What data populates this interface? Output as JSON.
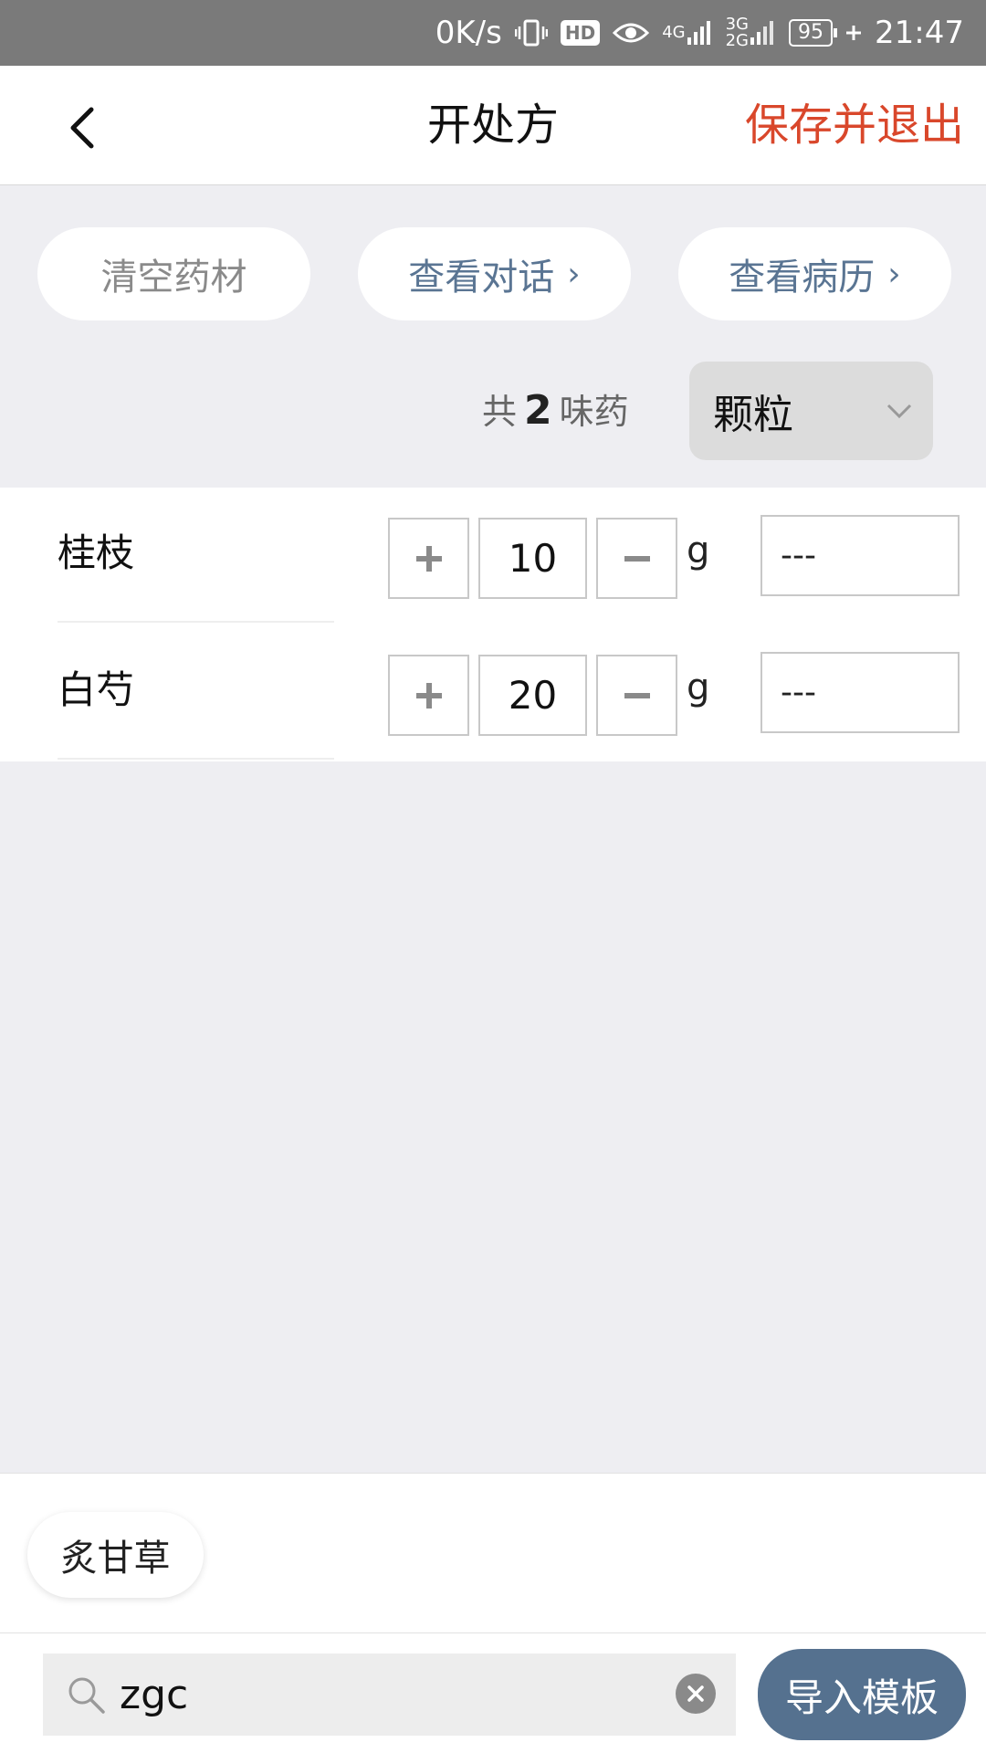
{
  "status_bar": {
    "speed": "0K/s",
    "hd": "HD",
    "net1_top": "4G",
    "net2_top": "3G",
    "net2_bottom": "2G",
    "battery": "95",
    "time": "21:47"
  },
  "header": {
    "title": "开处方",
    "save_exit": "保存并退出"
  },
  "actions": {
    "clear": "清空药材",
    "view_chat": "查看对话",
    "view_record": "查看病历",
    "chevron": "›"
  },
  "summary": {
    "prefix": "共",
    "count": "2",
    "suffix": "味药"
  },
  "dosage_form": {
    "selected": "颗粒"
  },
  "herbs": [
    {
      "name": "桂枝",
      "qty": "10",
      "unit": "g",
      "note": "---"
    },
    {
      "name": "白芍",
      "qty": "20",
      "unit": "g",
      "note": "---"
    }
  ],
  "suggestions": [
    "炙甘草"
  ],
  "search": {
    "value": "zgc",
    "import_label": "导入模板"
  }
}
